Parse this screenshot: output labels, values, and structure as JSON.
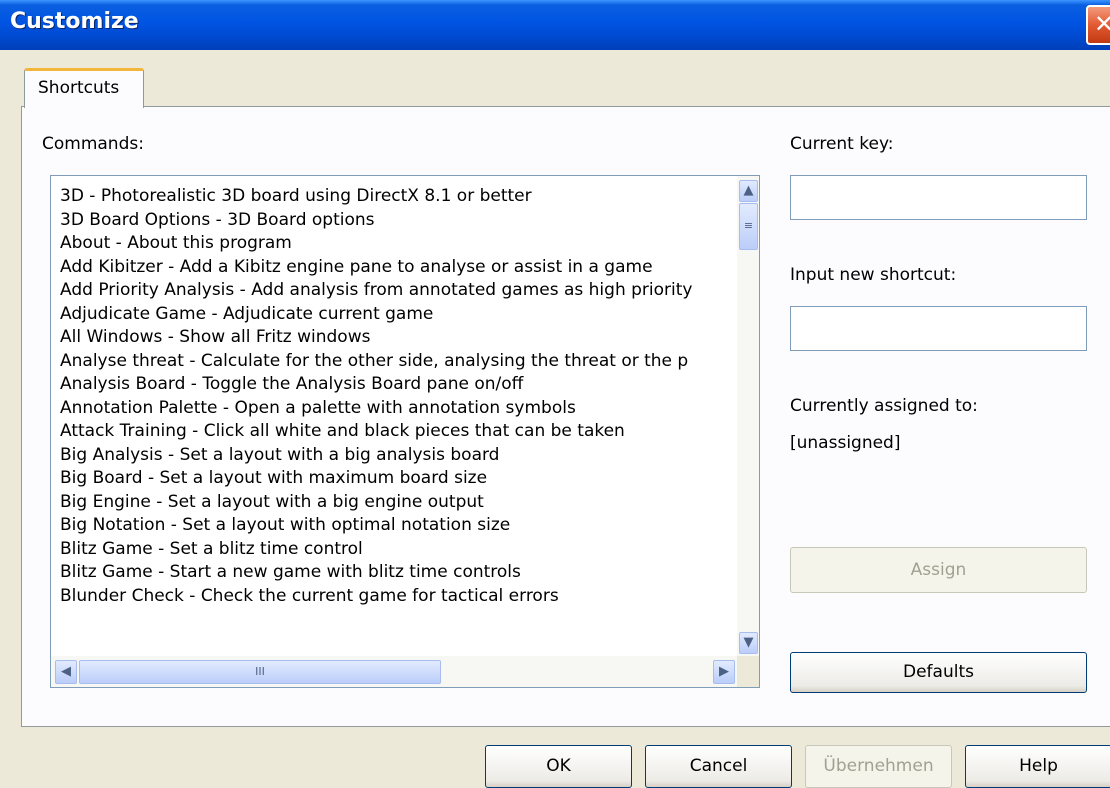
{
  "window": {
    "title": "Customize",
    "close_glyph": "✕"
  },
  "tabs": [
    {
      "label": "Shortcuts",
      "selected": true
    }
  ],
  "commands": {
    "label": "Commands:",
    "items": [
      "3D - Photorealistic 3D board using DirectX 8.1 or better",
      "3D Board Options - 3D Board options",
      "About - About this program",
      "Add Kibitzer - Add a Kibitz engine pane to analyse or assist in a game",
      "Add Priority Analysis - Add analysis from annotated games as high priority",
      "Adjudicate Game - Adjudicate current game",
      "All Windows - Show all Fritz windows",
      "Analyse threat - Calculate for the other side, analysing the threat or the p",
      "Analysis Board - Toggle the Analysis Board pane on/off",
      "Annotation Palette - Open a palette with annotation symbols",
      "Attack Training - Click all white and black pieces that can be taken",
      "Big Analysis - Set a layout with a big analysis board",
      "Big Board - Set a layout with maximum board size",
      "Big Engine - Set a layout with a big engine output",
      "Big Notation - Set a layout with optimal notation size",
      "Blitz Game - Set a blitz time control",
      "Blitz Game - Start a new game with blitz time controls",
      "Blunder Check - Check the current game for tactical errors"
    ]
  },
  "scrollbar_glyphs": {
    "up": "▲",
    "down": "▼",
    "left": "◀",
    "right": "▶",
    "grip_v": "≡",
    "grip_h": "III"
  },
  "current_key": {
    "label": "Current key:",
    "value": ""
  },
  "new_shortcut": {
    "label": "Input new shortcut:",
    "value": ""
  },
  "assigned": {
    "label": "Currently assigned to:",
    "value": "[unassigned]"
  },
  "buttons": {
    "assign": "Assign",
    "defaults": "Defaults",
    "ok": "OK",
    "cancel": "Cancel",
    "apply": "Übernehmen",
    "help": "Help"
  }
}
